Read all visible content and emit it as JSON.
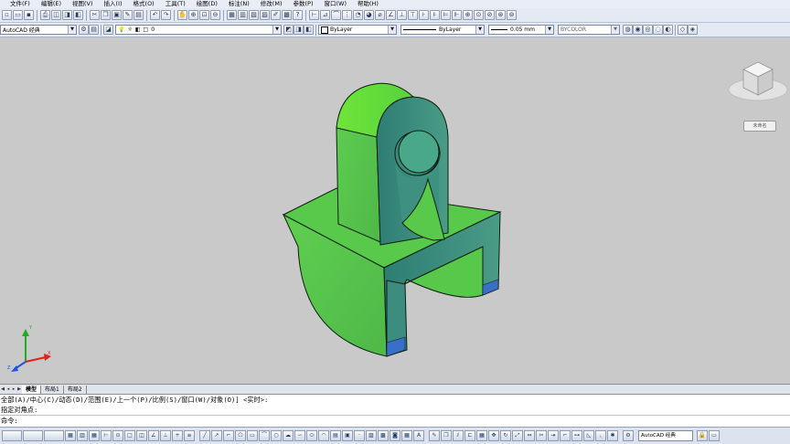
{
  "menubar": {
    "items": [
      "文件(F)",
      "编辑(E)",
      "视图(V)",
      "插入(I)",
      "格式(O)",
      "工具(T)",
      "绘图(D)",
      "标注(N)",
      "修改(M)",
      "参数(P)",
      "窗口(W)",
      "帮助(H)"
    ]
  },
  "toolbar2": {
    "workspace": "AutoCAD 经典",
    "layer": "0",
    "color": "ByLayer",
    "linetype": "ByLayer",
    "lineweight": "0.05 mm",
    "plotstyle": "BYCOLOR"
  },
  "viewcube": {
    "label": "未命名"
  },
  "tabs": {
    "items": [
      "模型",
      "布局1",
      "布局2"
    ]
  },
  "command": {
    "line1": "全部(A)/中心(C)/动态(D)/范围(E)/上一个(P)/比例(S)/窗口(W)/对象(O)] <实时>:",
    "line2": "指定对角点:",
    "prompt": "命令:"
  },
  "statusbar": {
    "workspace": "AutoCAD 经典"
  },
  "colors": {
    "model_green": "#5ccb4e",
    "model_teal": "#3a8f85",
    "edge": "#0d1e10",
    "background": "#c9c9c9"
  },
  "icons": [
    "new-icon",
    "open-icon",
    "save-icon",
    "print-icon",
    "undo-icon",
    "redo-icon",
    "pan-icon",
    "zoom-icon",
    "properties-icon",
    "dimension-icon",
    "viewcube-icon",
    "ucs-icon"
  ]
}
